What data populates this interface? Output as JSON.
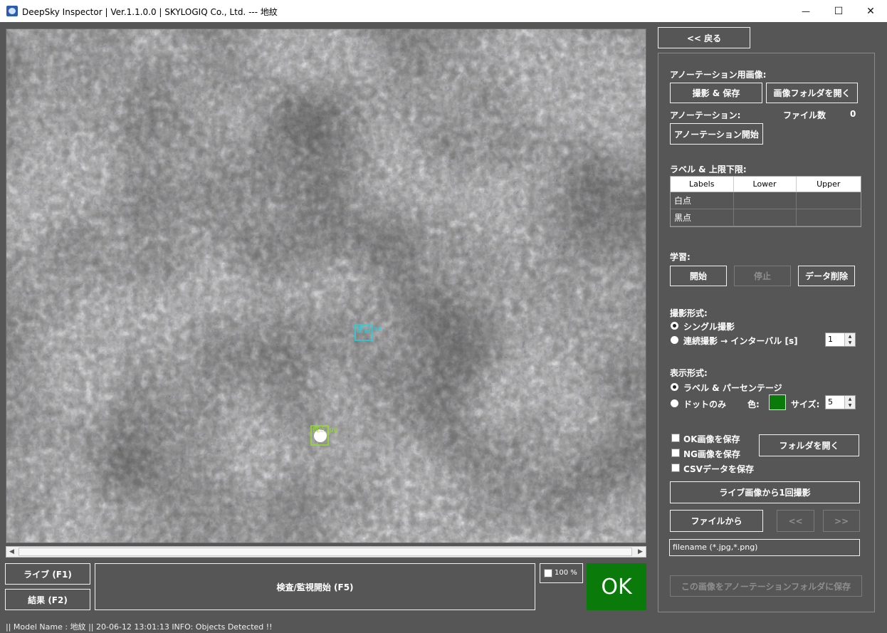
{
  "window": {
    "title": "DeepSky Inspector | Ver.1.1.0.0 | SKYLOGIQ Co., Ltd. --- 地紋",
    "min_glyph": "—",
    "max_glyph": "☐",
    "close_glyph": "✕"
  },
  "view": {
    "detections": [
      {
        "label": "黒点",
        "score": "98",
        "color": "#1fd3e0"
      },
      {
        "label": "白点",
        "score": "98",
        "color": "#8fe01f"
      }
    ]
  },
  "bottom": {
    "live_button": "ライブ (F1)",
    "result_button": "結果 (F2)",
    "inspect_button": "検査/監視開始 (F5)",
    "zoom_label": "100 %",
    "verdict": "OK",
    "verdict_color": "#0a7a0a"
  },
  "status_bar": {
    "text": "|| Model Name : 地紋 ||    20-06-12 13:01:13   INFO:   Objects Detected !!"
  },
  "panel": {
    "back_button": "<< 戻る",
    "annotation_images_label": "アノーテーション用画像:",
    "capture_save_button": "撮影 & 保存",
    "open_image_folder_button": "画像フォルダを開く",
    "annotation_label": "アノーテーション:",
    "file_count_label": "ファイル数",
    "file_count_value": "0",
    "annotation_start_button": "アノーテーション開始",
    "label_limits_label": "ラベル & 上限下限:",
    "table": {
      "headers": [
        "Labels",
        "Lower",
        "Upper"
      ],
      "rows": [
        [
          "白点",
          "",
          ""
        ],
        [
          "黒点",
          "",
          ""
        ]
      ]
    },
    "learning_label": "学習:",
    "start_button": "開始",
    "stop_button": "停止",
    "delete_data_button": "データ削除",
    "capture_mode_label": "撮影形式:",
    "single_capture": "シングル撮影",
    "continuous_capture": "連続撮影 → インターバル [s]",
    "interval_value": "1",
    "display_mode_label": "表示形式:",
    "label_percentage": "ラベル & パーセンテージ",
    "dot_only": "ドットのみ",
    "color_label": "色:",
    "size_label": "サイズ:",
    "size_value": "5",
    "dot_color": "#0a7a0a",
    "save_ok": "OK画像を保存",
    "save_ng": "NG画像を保存",
    "save_csv": "CSVデータを保存",
    "open_folder_button": "フォルダを開く",
    "capture_once_button": "ライブ画像から1回撮影",
    "from_file_button": "ファイルから",
    "prev_button": "<<",
    "next_button": ">>",
    "filename_value": "filename (*.jpg,*.png)",
    "save_to_annotation_button": "この画像をアノーテーションフォルダに保存"
  }
}
